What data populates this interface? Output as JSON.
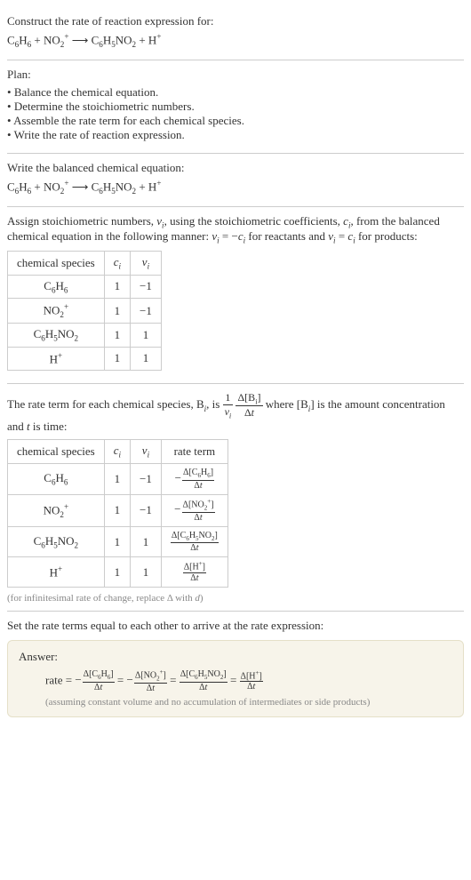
{
  "intro": {
    "prompt": "Construct the rate of reaction expression for:",
    "equation": "C6H6 + NO2+ ⟶ C6H5NO2 + H+"
  },
  "plan": {
    "label": "Plan:",
    "items": [
      "Balance the chemical equation.",
      "Determine the stoichiometric numbers.",
      "Assemble the rate term for each chemical species.",
      "Write the rate of reaction expression."
    ]
  },
  "balanced": {
    "label": "Write the balanced chemical equation:",
    "equation": "C6H6 + NO2+ ⟶ C6H5NO2 + H+"
  },
  "stoich": {
    "description_pre": "Assign stoichiometric numbers, ",
    "nu": "νᵢ",
    "description_mid1": ", using the stoichiometric coefficients, ",
    "ci": "cᵢ",
    "description_mid2": ", from the balanced chemical equation in the following manner: ",
    "rule_reactants": "νᵢ = −cᵢ",
    "for_reactants": " for reactants and ",
    "rule_products": "νᵢ = cᵢ",
    "for_products": " for products:",
    "table": {
      "headers": [
        "chemical species",
        "cᵢ",
        "νᵢ"
      ],
      "rows": [
        {
          "species": "C6H6",
          "ci": "1",
          "nu": "−1"
        },
        {
          "species": "NO2+",
          "ci": "1",
          "nu": "−1"
        },
        {
          "species": "C6H5NO2",
          "ci": "1",
          "nu": "1"
        },
        {
          "species": "H+",
          "ci": "1",
          "nu": "1"
        }
      ]
    }
  },
  "rateterm": {
    "text1": "The rate term for each chemical species, B",
    "sub_i": "i",
    "text2": ", is ",
    "frac1_num": "1",
    "frac1_den": "νᵢ",
    "frac2_num": "Δ[Bᵢ]",
    "frac2_den": "Δt",
    "text3": " where [B",
    "text4": "] is the amount concentration and ",
    "t": "t",
    "text5": " is time:",
    "table": {
      "headers": [
        "chemical species",
        "cᵢ",
        "νᵢ",
        "rate term"
      ],
      "rows": [
        {
          "species": "C6H6",
          "ci": "1",
          "nu": "−1",
          "rate_sign": "−",
          "rate_num": "Δ[C6H6]",
          "rate_den": "Δt"
        },
        {
          "species": "NO2+",
          "ci": "1",
          "nu": "−1",
          "rate_sign": "−",
          "rate_num": "Δ[NO2+]",
          "rate_den": "Δt"
        },
        {
          "species": "C6H5NO2",
          "ci": "1",
          "nu": "1",
          "rate_sign": "",
          "rate_num": "Δ[C6H5NO2]",
          "rate_den": "Δt"
        },
        {
          "species": "H+",
          "ci": "1",
          "nu": "1",
          "rate_sign": "",
          "rate_num": "Δ[H+]",
          "rate_den": "Δt"
        }
      ]
    },
    "caption": "(for infinitesimal rate of change, replace Δ with d)"
  },
  "conclusion": {
    "text": "Set the rate terms equal to each other to arrive at the rate expression:"
  },
  "answer": {
    "label": "Answer:",
    "rate_label": "rate = ",
    "terms": [
      {
        "sign": "−",
        "num": "Δ[C6H6]",
        "den": "Δt"
      },
      {
        "sign": "−",
        "num": "Δ[NO2+]",
        "den": "Δt"
      },
      {
        "sign": "",
        "num": "Δ[C6H5NO2]",
        "den": "Δt"
      },
      {
        "sign": "",
        "num": "Δ[H+]",
        "den": "Δt"
      }
    ],
    "eq": " = ",
    "assumption": "(assuming constant volume and no accumulation of intermediates or side products)"
  }
}
